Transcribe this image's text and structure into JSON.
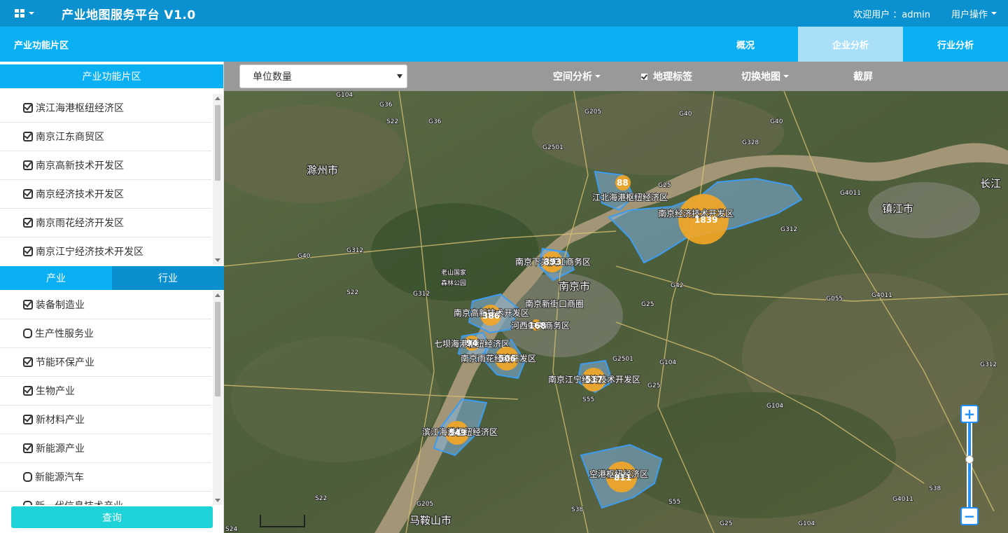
{
  "header": {
    "title": "产业地图服务平台 V1.0",
    "welcome": "欢迎用户 ：admin",
    "user_ops": "用户操作"
  },
  "nav": {
    "left_title": "产业功能片区",
    "tabs": [
      "概况",
      "企业分析",
      "行业分析"
    ],
    "active_tab": "企业分析"
  },
  "zones_panel": {
    "title": "产业功能片区",
    "items": [
      {
        "label": "滨江海港枢纽经济区",
        "checked": true
      },
      {
        "label": "南京江东商贸区",
        "checked": true
      },
      {
        "label": "南京高新技术开发区",
        "checked": true
      },
      {
        "label": "南京经济技术开发区",
        "checked": true
      },
      {
        "label": "南京雨花经济开发区",
        "checked": true
      },
      {
        "label": "南京江宁经济技术开发区",
        "checked": true
      }
    ]
  },
  "industry_panel": {
    "tabs": [
      "产业",
      "行业"
    ],
    "items": [
      {
        "label": "装备制造业",
        "checked": true
      },
      {
        "label": "生产性服务业",
        "checked": false
      },
      {
        "label": "节能环保产业",
        "checked": true
      },
      {
        "label": "生物产业",
        "checked": true
      },
      {
        "label": "新材料产业",
        "checked": true
      },
      {
        "label": "新能源产业",
        "checked": true
      },
      {
        "label": "新能源汽车",
        "checked": false
      },
      {
        "label": "新一代信息技术产业",
        "checked": false
      }
    ],
    "query_button": "查询"
  },
  "map_toolbar": {
    "select_value": "单位数量",
    "spatial_analysis": "空间分析",
    "geo_tag": "地理标签",
    "geo_tag_checked": true,
    "switch_map": "切换地图",
    "screenshot": "截屏"
  },
  "map": {
    "city_label": "南京市",
    "zhenjiang_label": "镇江市",
    "chuzhou_label": "滁州市",
    "maanshan_label": "马鞍山市",
    "park_label": "老山国家森林公园",
    "clusters": [
      {
        "value": "1839",
        "zone": "南京经济技术开发区"
      },
      {
        "value": "88",
        "zone": "江北海港枢纽经济区"
      },
      {
        "value": "393",
        "zone": "南京下关滨江商务区"
      },
      {
        "value": "386",
        "zone": "南京高新技术开发区"
      },
      {
        "value": "94",
        "zone": "七坝海港枢纽经济区"
      },
      {
        "value": "168",
        "zone": "河西中央商务区"
      },
      {
        "value": "506",
        "zone": "南京雨花经济开发区"
      },
      {
        "value": "517",
        "zone": "南京江宁经济技术开发区"
      },
      {
        "value": "543",
        "zone": "滨江海港枢纽经济区"
      },
      {
        "value": "811",
        "zone": "空港枢纽经济区"
      }
    ],
    "extra_zone_label": "南京新街口商圈",
    "place_names": [
      "G104",
      "G36",
      "S22",
      "G36",
      "G205",
      "G40",
      "G40",
      "G40",
      "G328",
      "G2501",
      "G25",
      "G4011",
      "G312",
      "G312",
      "G312",
      "G312",
      "G40",
      "S22",
      "G42",
      "G25",
      "G055",
      "G4011",
      "G312",
      "G25",
      "G2501",
      "G104",
      "G104",
      "S55",
      "S38",
      "S38",
      "G4011",
      "G205",
      "S22",
      "S24",
      "G25",
      "G104",
      "S55",
      "长江",
      "镇江市",
      "长江"
    ]
  },
  "colors": {
    "header_bg": "#0b91d0",
    "nav_bg": "#0bb0f2",
    "active_tab": "#a9dff8",
    "query_button": "#1dd3d8",
    "cluster": "#f5a623",
    "zone_fill": "#7fb3e0"
  }
}
